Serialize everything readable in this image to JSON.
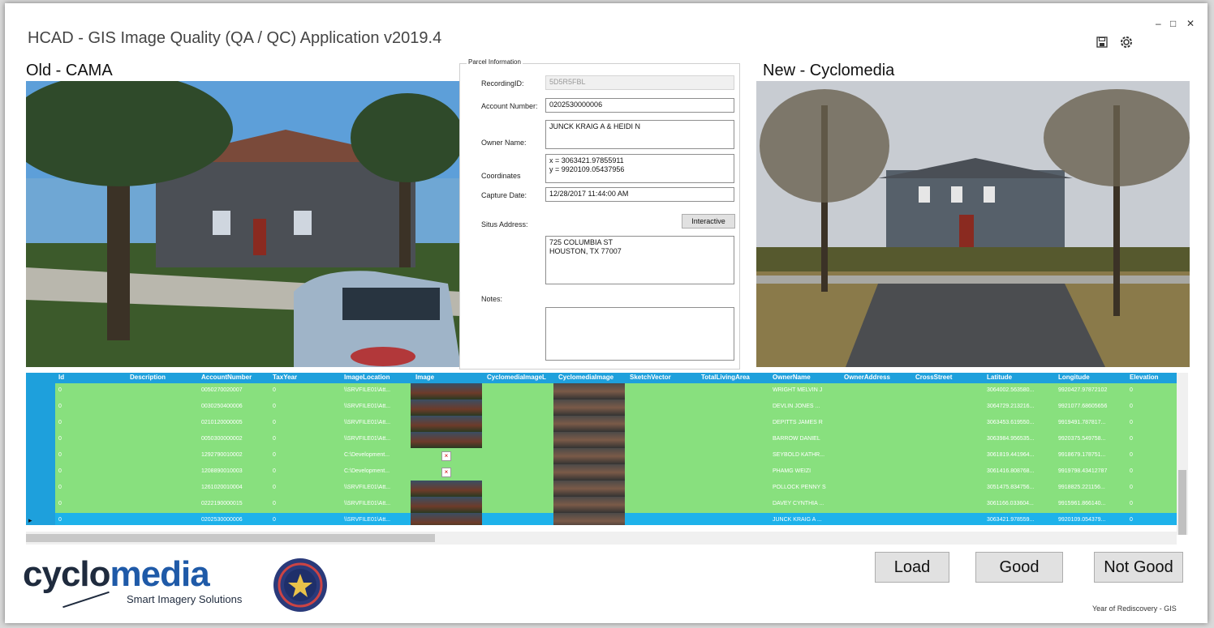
{
  "app": {
    "title": "HCAD - GIS Image Quality (QA / QC) Application v2019.4",
    "minimize": "‒",
    "maximize": "□",
    "close": "✕",
    "save_icon": "save-icon",
    "settings_icon": "gear-icon"
  },
  "sections": {
    "old_label": "Old - CAMA",
    "new_label": "New - Cyclomedia"
  },
  "parcel": {
    "legend": "Parcel Information",
    "recording_id_label": "RecordingID:",
    "recording_id": "5D5R5FBL",
    "account_label": "Account Number:",
    "account": "0202530000006",
    "owner_label": "Owner Name:",
    "owner": "JUNCK KRAIG A & HEIDI N",
    "coords_label": "Coordinates",
    "coords": "x = 3063421.97855911\ny = 9920109.05437956",
    "capture_label": "Capture Date:",
    "capture": "12/28/2017 11:44:00 AM",
    "situs_label": "Situs Address:",
    "interactive_btn": "Interactive",
    "situs": "725 COLUMBIA ST\nHOUSTON, TX 77007",
    "notes_label": "Notes:",
    "notes": ""
  },
  "grid": {
    "columns": [
      "Id",
      "Description",
      "AccountNumber",
      "TaxYear",
      "ImageLocation",
      "Image",
      "CyclomediaImageL",
      "CyclomediaImage",
      "SketchVector",
      "TotalLivingArea",
      "OwnerName",
      "OwnerAddress",
      "CrossStreet",
      "Latitude",
      "Longitude",
      "Elevation"
    ],
    "rows": [
      {
        "id": "0",
        "account": "0050270020007",
        "tax": "0",
        "loc": "\\\\SRVFILE01\\Att...",
        "owner": "WRIGHT MELVIN J",
        "lat": "3064002.563580...",
        "lon": "9920427.97872102",
        "elev": "0"
      },
      {
        "id": "0",
        "account": "0030250400006",
        "tax": "0",
        "loc": "\\\\SRVFILE01\\Att...",
        "owner": "DEVLIN JONES ...",
        "lat": "3064729.213216...",
        "lon": "9921077.68605656",
        "elev": "0"
      },
      {
        "id": "0",
        "account": "0210120000005",
        "tax": "0",
        "loc": "\\\\SRVFILE01\\Att...",
        "owner": "DEPITTS JAMES R",
        "lat": "3063453.619550...",
        "lon": "9919491.787817...",
        "elev": "0"
      },
      {
        "id": "0",
        "account": "0050300000002",
        "tax": "0",
        "loc": "\\\\SRVFILE01\\Att...",
        "owner": "BARROW DANIEL",
        "lat": "3063984.956535...",
        "lon": "9920375.549758...",
        "elev": "0"
      },
      {
        "id": "0",
        "account": "1292790010002",
        "tax": "0",
        "loc": "C:\\Development...",
        "owner": "SEYBOLD KATHR...",
        "lat": "3061819.441964...",
        "lon": "9918679.178751...",
        "elev": "0"
      },
      {
        "id": "0",
        "account": "1208890010003",
        "tax": "0",
        "loc": "C:\\Development...",
        "owner": "PHAMG WEIZI",
        "lat": "3061416.808768...",
        "lon": "9919798.43412787",
        "elev": "0"
      },
      {
        "id": "0",
        "account": "1261020010004",
        "tax": "0",
        "loc": "\\\\SRVFILE01\\Att...",
        "owner": "POLLOCK PENNY S",
        "lat": "3051475.834756...",
        "lon": "9918825.221156...",
        "elev": "0"
      },
      {
        "id": "0",
        "account": "0222190000015",
        "tax": "0",
        "loc": "\\\\SRVFILE01\\Att...",
        "owner": "DAVEY CYNTHIA ...",
        "lat": "3061166.033604...",
        "lon": "9915961.866140...",
        "elev": "0"
      },
      {
        "id": "0",
        "account": "0202530000006",
        "tax": "0",
        "loc": "\\\\SRVFILE01\\Att...",
        "owner": "JUNCK KRAIG A ...",
        "lat": "3063421.978559...",
        "lon": "9920109.054379...",
        "elev": "0"
      }
    ],
    "current_row_marker": "▸"
  },
  "actions": {
    "load": "Load",
    "good": "Good",
    "not_good": "Not Good"
  },
  "branding": {
    "logo_part1": "cyclo",
    "logo_part2": "media",
    "tagline": "Smart Imagery Solutions",
    "footnote": "Year of Rediscovery - GIS"
  },
  "colors": {
    "grid_header": "#1ea0dc",
    "row_fill": "#88e07e",
    "row_selected": "#1eb2ea"
  }
}
